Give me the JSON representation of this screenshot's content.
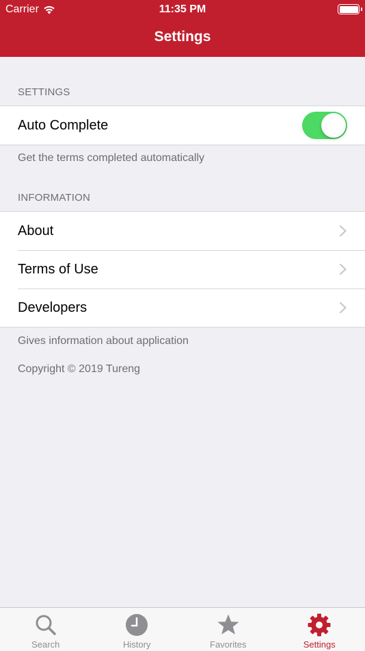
{
  "status_bar": {
    "carrier": "Carrier",
    "time": "11:35 PM"
  },
  "nav": {
    "title": "Settings"
  },
  "sections": {
    "settings": {
      "header": "SETTINGS",
      "auto_complete_label": "Auto Complete",
      "auto_complete_on": true,
      "footer": "Get the terms completed automatically"
    },
    "information": {
      "header": "INFORMATION",
      "items": [
        {
          "label": "About"
        },
        {
          "label": "Terms of Use"
        },
        {
          "label": "Developers"
        }
      ],
      "footer": "Gives information about application"
    },
    "copyright": "Copyright © 2019 Tureng"
  },
  "tabs": [
    {
      "label": "Search",
      "icon": "search-icon",
      "active": false
    },
    {
      "label": "History",
      "icon": "clock-icon",
      "active": false
    },
    {
      "label": "Favorites",
      "icon": "star-icon",
      "active": false
    },
    {
      "label": "Settings",
      "icon": "gear-icon",
      "active": true
    }
  ],
  "colors": {
    "brand": "#c21f2e",
    "toggle_on": "#4cd964",
    "tab_inactive": "#8e8e93"
  }
}
